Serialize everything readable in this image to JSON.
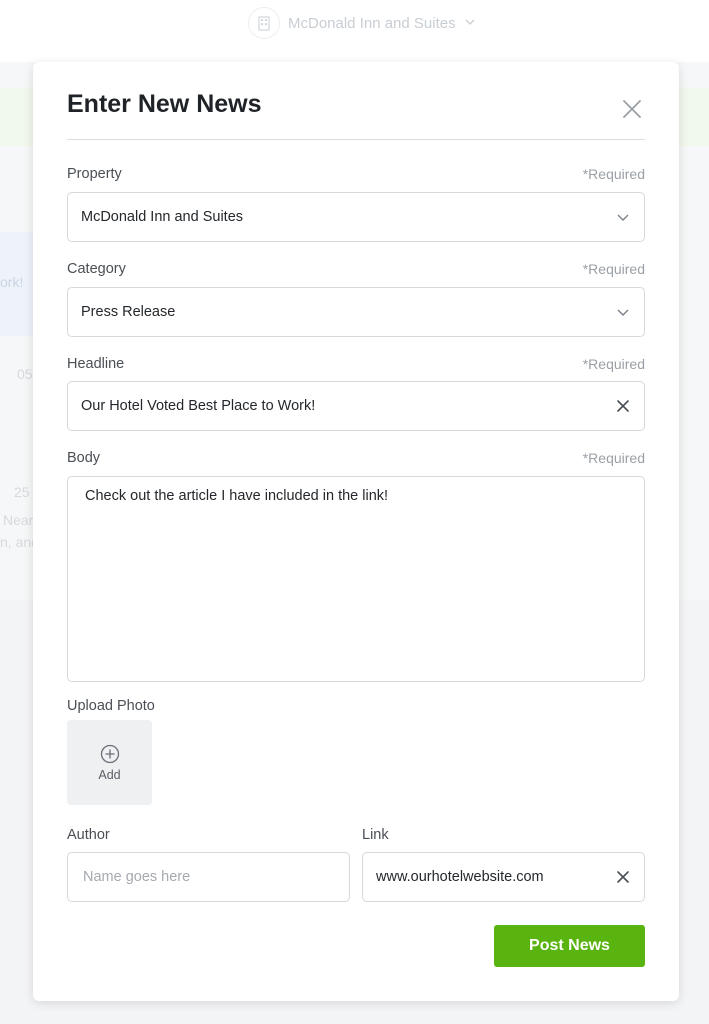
{
  "background": {
    "property_selector": "McDonald Inn and Suites",
    "fragments": {
      "work": "ork!",
      "num1": "05",
      "num2": "25",
      "near": "Near",
      "and": "n, and"
    }
  },
  "modal": {
    "title": "Enter New News",
    "required_text": "*Required",
    "property": {
      "label": "Property",
      "value": "McDonald Inn and Suites"
    },
    "category": {
      "label": "Category",
      "value": "Press Release"
    },
    "headline": {
      "label": "Headline",
      "value": "Our Hotel Voted Best Place to Work!"
    },
    "body": {
      "label": "Body",
      "value": "Check out the article I have included in the link!"
    },
    "upload": {
      "label": "Upload Photo",
      "add_label": "Add"
    },
    "author": {
      "label": "Author",
      "value": "",
      "placeholder": "Name goes here"
    },
    "link": {
      "label": "Link",
      "value": "www.ourhotelwebsite.com"
    },
    "submit_label": "Post News"
  },
  "colors": {
    "accent": "#5ab40f",
    "border": "#d5d9dd",
    "required": "#9aa0a6"
  },
  "icons": [
    "building-icon",
    "chevron-down-icon",
    "close-icon",
    "clear-icon",
    "plus-circle-icon"
  ]
}
